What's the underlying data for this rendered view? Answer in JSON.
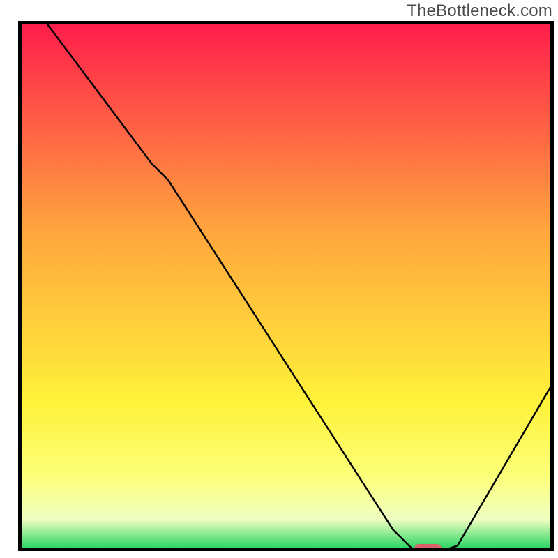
{
  "watermark": "TheBottleneck.com",
  "colors": {
    "border": "#000000",
    "curve": "#000000",
    "marker": "#d9616a",
    "grad_top": "#ff1c4b",
    "grad_mid1": "#ffa73d",
    "grad_mid2": "#fff23a",
    "grad_mid3": "#fcff7a",
    "grad_mid4": "#f0ffc2",
    "grad_bottom": "#18d15a"
  },
  "chart_data": {
    "type": "line",
    "title": "",
    "xlabel": "",
    "ylabel": "",
    "xlim": [
      0,
      100
    ],
    "ylim": [
      0,
      100
    ],
    "x": [
      0,
      5,
      25,
      28,
      70,
      74,
      79,
      82,
      100
    ],
    "series": [
      {
        "name": "curve",
        "values": [
          100,
          100,
          73,
          70,
          4,
          0,
          0,
          1,
          32
        ]
      }
    ],
    "marker": {
      "x_start": 74,
      "x_end": 79,
      "y": 0
    },
    "gradient_stops": [
      {
        "pos": 0,
        "hex": "#ff1c4b"
      },
      {
        "pos": 40,
        "hex": "#ffa73d"
      },
      {
        "pos": 72,
        "hex": "#fff23a"
      },
      {
        "pos": 86,
        "hex": "#fcff7a"
      },
      {
        "pos": 94,
        "hex": "#f0ffc2"
      },
      {
        "pos": 100,
        "hex": "#18d15a"
      }
    ]
  }
}
